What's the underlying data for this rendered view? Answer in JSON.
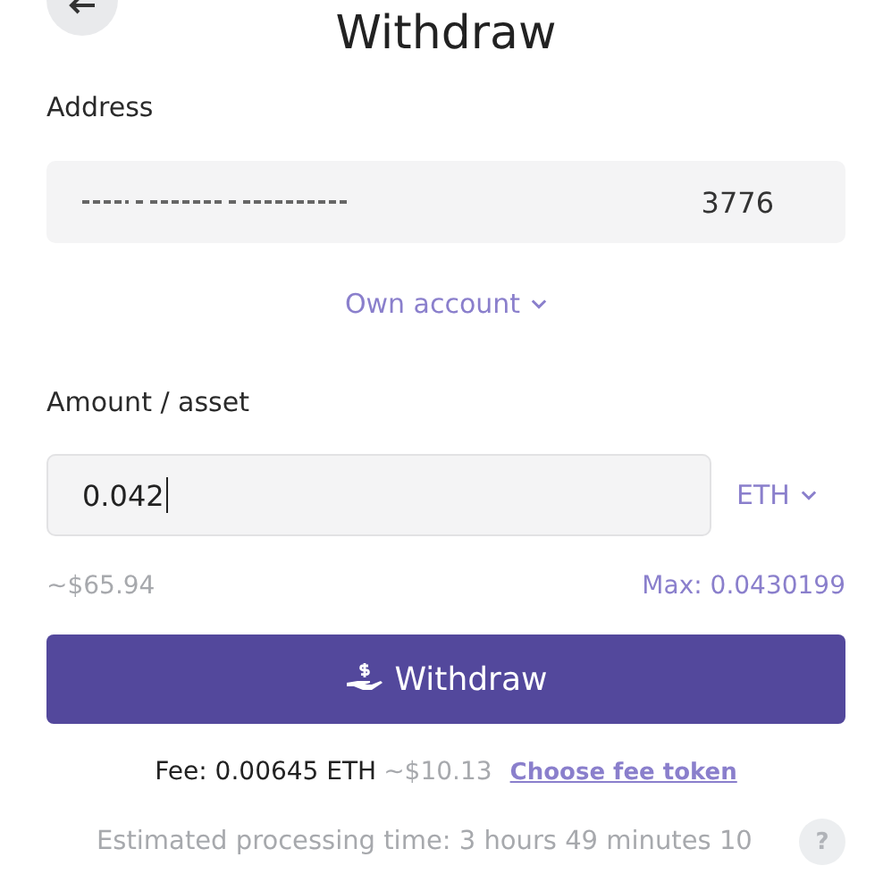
{
  "header": {
    "title": "Withdraw"
  },
  "address": {
    "label": "Address",
    "value": "3776"
  },
  "recipient": {
    "label": "Own account"
  },
  "amount": {
    "label": "Amount / asset",
    "value": "0.042",
    "asset": "ETH",
    "usd": "~$65.94",
    "max": "Max: 0.0430199"
  },
  "submit": {
    "label": "Withdraw"
  },
  "fee": {
    "text": "Fee: 0.00645 ETH",
    "usd": "~$10.13",
    "link": "Choose fee token"
  },
  "estimate": {
    "text": "Estimated processing time: 3 hours 49 minutes 10",
    "help": "?"
  }
}
